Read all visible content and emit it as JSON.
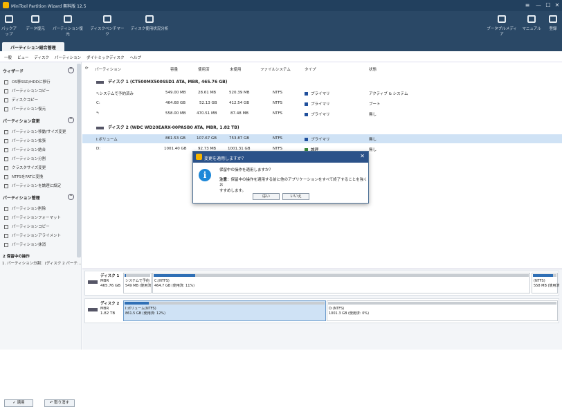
{
  "app": {
    "title": "MiniTool Partition Wizard 無料版 12.5",
    "window_controls": [
      "≡",
      "—",
      "☐",
      "✕"
    ]
  },
  "toolbar": {
    "left": [
      {
        "label": "バックアップ",
        "icon": "backup-icon"
      },
      {
        "label": "データ復元",
        "icon": "data-recovery-icon"
      },
      {
        "label": "パーティション復元",
        "icon": "partition-recovery-icon"
      },
      {
        "label": "ディスクベンチマーク",
        "icon": "disk-benchmark-icon"
      },
      {
        "label": "ディスク使用状況分析",
        "icon": "space-analyzer-icon"
      }
    ],
    "right": [
      {
        "label": "ブータブルメディア",
        "icon": "bootable-media-icon"
      },
      {
        "label": "マニュアル",
        "icon": "manual-icon"
      },
      {
        "label": "登録",
        "icon": "register-icon"
      }
    ]
  },
  "main_tab": "パーティション総合管理",
  "menu": [
    "一般",
    "ビュー",
    "ディスク",
    "パーティション",
    "ダイナミックディスク",
    "ヘルプ"
  ],
  "sidebar": {
    "wizard_title": "ウィザード",
    "wizard_items": [
      "OS移SSD/HDDに移行",
      "パーティションコピー",
      "ディスクコピー",
      "パーティション復元"
    ],
    "change_title": "パーティション変更",
    "change_items": [
      "パーティション移動/サイズ変更",
      "パーティション拡張",
      "パーティション結合",
      "パーティション分割",
      "クラスタサイズ変更",
      "NTFSをFATに変換",
      "パーティションを論理に設定"
    ],
    "manage_title": "パーティション管理",
    "manage_items": [
      "パーティション削除",
      "パーティションフォーマット",
      "パーティションコピー",
      "パーティションアライメント",
      "パーティション抹消"
    ],
    "pending_title": "2 保留中の操作",
    "pending_items": [
      "1. パーティション分割：(ディスク 2 パーテ..."
    ],
    "apply_label": "✓ 適用",
    "undo_label": "↶ 取り消す"
  },
  "table": {
    "headers": [
      "パーティション",
      "容量",
      "使用済",
      "未使用",
      "ファイルシステム",
      "タイプ",
      "状態"
    ],
    "disk1": "ディスク 1 (CT500MX500SSD1 ATA, MBR, 465.76 GB)",
    "disk1_rows": [
      {
        "name": "*:システムで予約済み",
        "cap": "549.00 MB",
        "used": "28.61 MB",
        "free": "520.39 MB",
        "fs": "NTFS",
        "type": "プライマリ",
        "status": "アクティブ & システム"
      },
      {
        "name": "C:",
        "cap": "464.68 GB",
        "used": "52.13 GB",
        "free": "412.54 GB",
        "fs": "NTFS",
        "type": "プライマリ",
        "status": "ブート"
      },
      {
        "name": "*:",
        "cap": "558.00 MB",
        "used": "470.51 MB",
        "free": "87.48 MB",
        "fs": "NTFS",
        "type": "プライマリ",
        "status": "無し"
      }
    ],
    "disk2": "ディスク 2 (WDC WD20EARX-00PASB0 ATA, MBR, 1.82 TB)",
    "disk2_rows": [
      {
        "name": "I:ボリューム",
        "cap": "861.53 GB",
        "used": "107.67 GB",
        "free": "753.87 GB",
        "fs": "NTFS",
        "type": "プライマリ",
        "status": "無し"
      },
      {
        "name": "D:",
        "cap": "1001.40 GB",
        "used": "92.73 MB",
        "free": "1001.31 GB",
        "fs": "NTFS",
        "type": "論理",
        "status": "無し"
      }
    ]
  },
  "diskmap": {
    "disk1": {
      "name": "ディスク 1",
      "style": "MBR",
      "size": "465.76 GB",
      "parts": [
        {
          "l1": "システムで予約",
          "l2": "549 MB (使用済",
          "fill": 0.05
        },
        {
          "l1": "C:(NTFS)",
          "l2": "464.7 GB (使用済: 11%)",
          "fill": 0.11
        },
        {
          "l1": "(NTFS)",
          "l2": "558 MB (使用済",
          "fill": 0.84
        }
      ]
    },
    "disk2": {
      "name": "ディスク 2",
      "style": "MBR",
      "size": "1.82 TB",
      "parts": [
        {
          "l1": "I:ボリューム(NTFS)",
          "l2": "861.5 GB (使用済: 12%)",
          "fill": 0.12
        },
        {
          "l1": "D:(NTFS)",
          "l2": "1001.3 GB (使用済: 0%)",
          "fill": 0.0
        }
      ]
    }
  },
  "dialog": {
    "title": "変更を適用しますか？",
    "question": "保留中の操作を適用しますか？",
    "note_bold": "注意",
    "note_line1": "：保留中の操作を適用する前に他のアプリケーションをすべて終了することを強くお",
    "note_line2": "すすめします。",
    "yes": "はい",
    "no": "いいえ"
  }
}
